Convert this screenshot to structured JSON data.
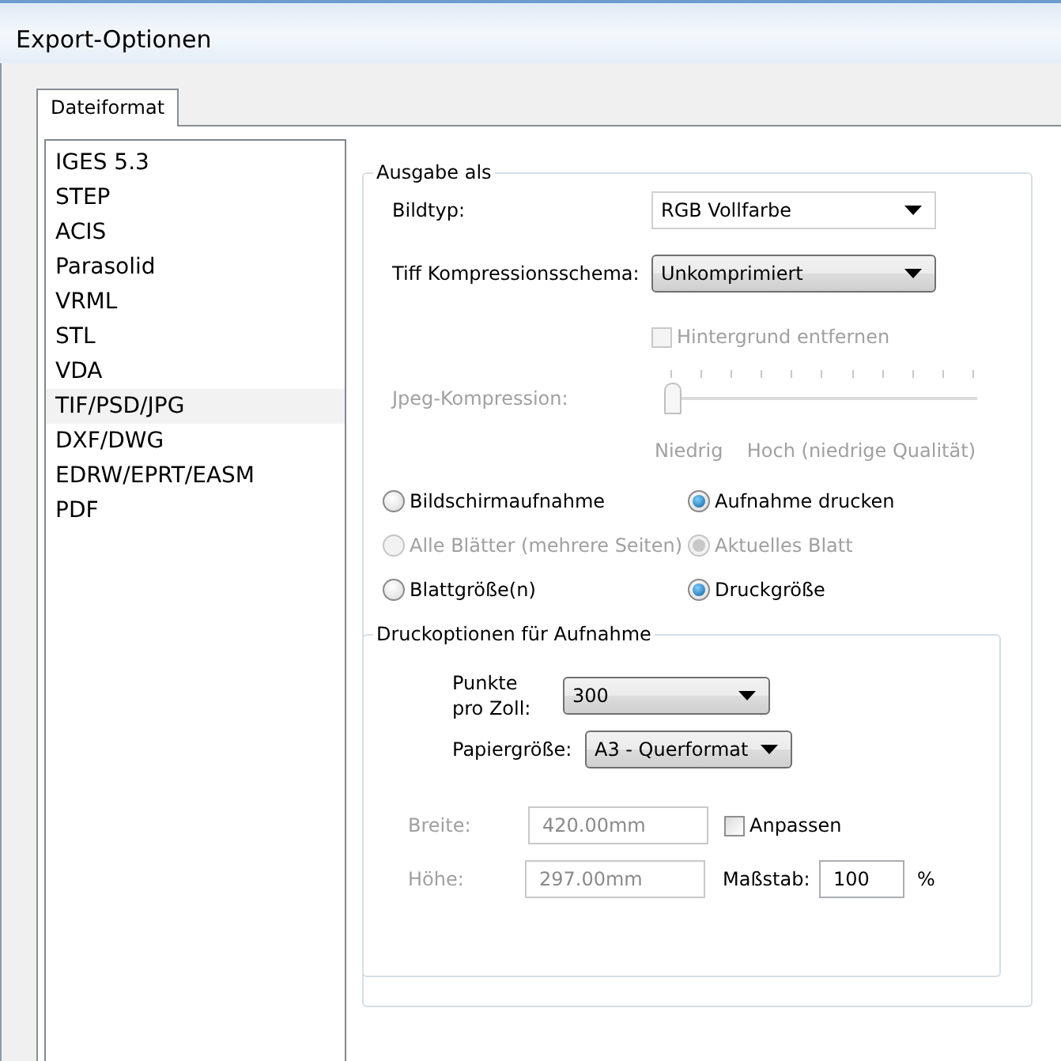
{
  "window": {
    "title": "Export-Optionen"
  },
  "tabs": [
    {
      "label": "Dateiformat",
      "selected": true
    }
  ],
  "formats": [
    {
      "label": "IGES 5.3",
      "selected": false
    },
    {
      "label": "STEP",
      "selected": false
    },
    {
      "label": "ACIS",
      "selected": false
    },
    {
      "label": "Parasolid",
      "selected": false
    },
    {
      "label": "VRML",
      "selected": false
    },
    {
      "label": "STL",
      "selected": false
    },
    {
      "label": "VDA",
      "selected": false
    },
    {
      "label": "TIF/PSD/JPG",
      "selected": true
    },
    {
      "label": "DXF/DWG",
      "selected": false
    },
    {
      "label": "EDRW/EPRT/EASM",
      "selected": false
    },
    {
      "label": "PDF",
      "selected": false
    }
  ],
  "output_group": {
    "legend": "Ausgabe als",
    "image_type": {
      "label": "Bildtyp:",
      "value": "RGB Vollfarbe",
      "raised": false
    },
    "compression": {
      "label": "Tiff Kompressionsschema:",
      "value": "Unkomprimiert",
      "raised": true
    },
    "remove_background": {
      "label": "Hintergrund entfernen",
      "checked": false,
      "disabled": true
    },
    "jpeg_compression": {
      "label": "Jpeg-Kompression:",
      "level": 0,
      "disabled": true,
      "min_label": "Niedrig",
      "max_label": "Hoch (niedrige Qualität)"
    },
    "radio_rows": [
      [
        {
          "label": "Bildschirmaufnahme",
          "selected": false,
          "disabled": false
        },
        {
          "label": "Aufnahme drucken",
          "selected": true,
          "disabled": false
        }
      ],
      [
        {
          "label": "Alle Blätter (mehrere Seiten)",
          "selected": false,
          "disabled": true
        },
        {
          "label": "Aktuelles Blatt",
          "selected": true,
          "disabled": true
        }
      ],
      [
        {
          "label": "Blattgröße(n)",
          "selected": false,
          "disabled": false
        },
        {
          "label": "Druckgröße",
          "selected": true,
          "disabled": false
        }
      ]
    ]
  },
  "print_group": {
    "legend": "Druckoptionen für Aufnahme",
    "dpi": {
      "label": "Punkte pro Zoll:",
      "value": "300",
      "raised": true
    },
    "paper_size": {
      "label": "Papiergröße:",
      "value": "A3 - Querformat",
      "raised": true
    },
    "width": {
      "label": "Breite:",
      "value": "420.00mm",
      "disabled": true
    },
    "fit": {
      "label": "Anpassen",
      "checked": false
    },
    "height": {
      "label": "Höhe:",
      "value": "297.00mm",
      "disabled": true
    },
    "scale": {
      "label": "Maßstab:",
      "value": "100",
      "unit": "%"
    }
  }
}
